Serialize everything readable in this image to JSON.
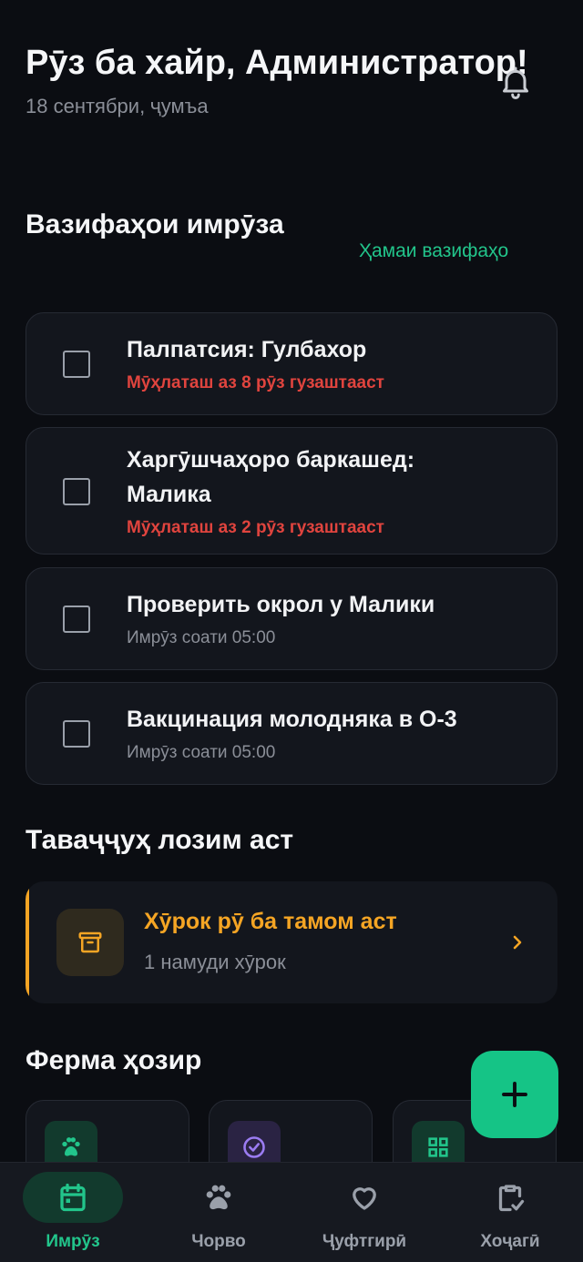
{
  "header": {
    "greeting": "Рӯз ба хайр, Администратор!",
    "date": "18 сентябри, ҷумъа"
  },
  "today_tasks": {
    "title": "Вазифаҳои имрӯза",
    "all_link": "Ҳамаи вазифаҳо",
    "items": [
      {
        "title": "Палпатсия: Гулбахор",
        "subtitle": "Мӯҳлаташ аз 8 рӯз гузаштааст",
        "status": "overdue"
      },
      {
        "title": "Харгӯшчаҳоро баркашед: Малика",
        "subtitle": "Мӯҳлаташ аз 2 рӯз гузаштааст",
        "status": "overdue"
      },
      {
        "title": "Проверить окрол у Малики",
        "subtitle": "Имрӯз соати 05:00",
        "status": "today"
      },
      {
        "title": "Вакцинация молодняка в О-3",
        "subtitle": "Имрӯз соати 05:00",
        "status": "today"
      }
    ]
  },
  "attention": {
    "title": "Таваҷҷуҳ лозим аст",
    "alert_title": "Хӯрок рӯ ба тамом аст",
    "alert_subtitle": "1 намуди хӯрок"
  },
  "farm_now": {
    "title": "Ферма ҳозир"
  },
  "nav": {
    "items": [
      {
        "label": "Имрӯз",
        "icon": "calendar-icon",
        "active": true
      },
      {
        "label": "Чорво",
        "icon": "paw-icon",
        "active": false
      },
      {
        "label": "Ҷуфтгирӣ",
        "icon": "heart-icon",
        "active": false
      },
      {
        "label": "Хоҷагӣ",
        "icon": "clipboard-check-icon",
        "active": false
      }
    ]
  },
  "colors": {
    "accent": "#22c58b",
    "overdue": "#e0443e",
    "warning": "#f5a524",
    "background": "#0b0d12"
  }
}
